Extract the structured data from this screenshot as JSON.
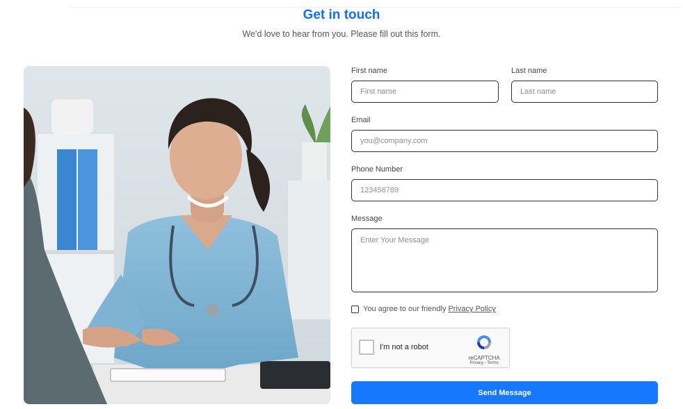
{
  "header": {
    "title": "Get in touch",
    "subtitle": "We'd love to hear from you. Please fill out this form."
  },
  "form": {
    "first_name": {
      "label": "First name",
      "placeholder": "First name",
      "value": ""
    },
    "last_name": {
      "label": "Last name",
      "placeholder": "Last name",
      "value": ""
    },
    "email": {
      "label": "Email",
      "placeholder": "you@company.com",
      "value": ""
    },
    "phone": {
      "label": "Phone Number",
      "placeholder": "123456789",
      "value": ""
    },
    "message": {
      "label": "Message",
      "placeholder": "Enter Your Message",
      "value": ""
    },
    "agree": {
      "text": "You agree to our friendly",
      "link": "Privacy Policy",
      "checked": false
    },
    "captcha": {
      "label": "I'm not a robot",
      "brand": "reCAPTCHA",
      "links": "Privacy - Terms",
      "icon": "recaptcha-icon"
    },
    "submit_label": "Send Message"
  },
  "colors": {
    "accent": "#1677ff",
    "title": "#1470e8"
  }
}
